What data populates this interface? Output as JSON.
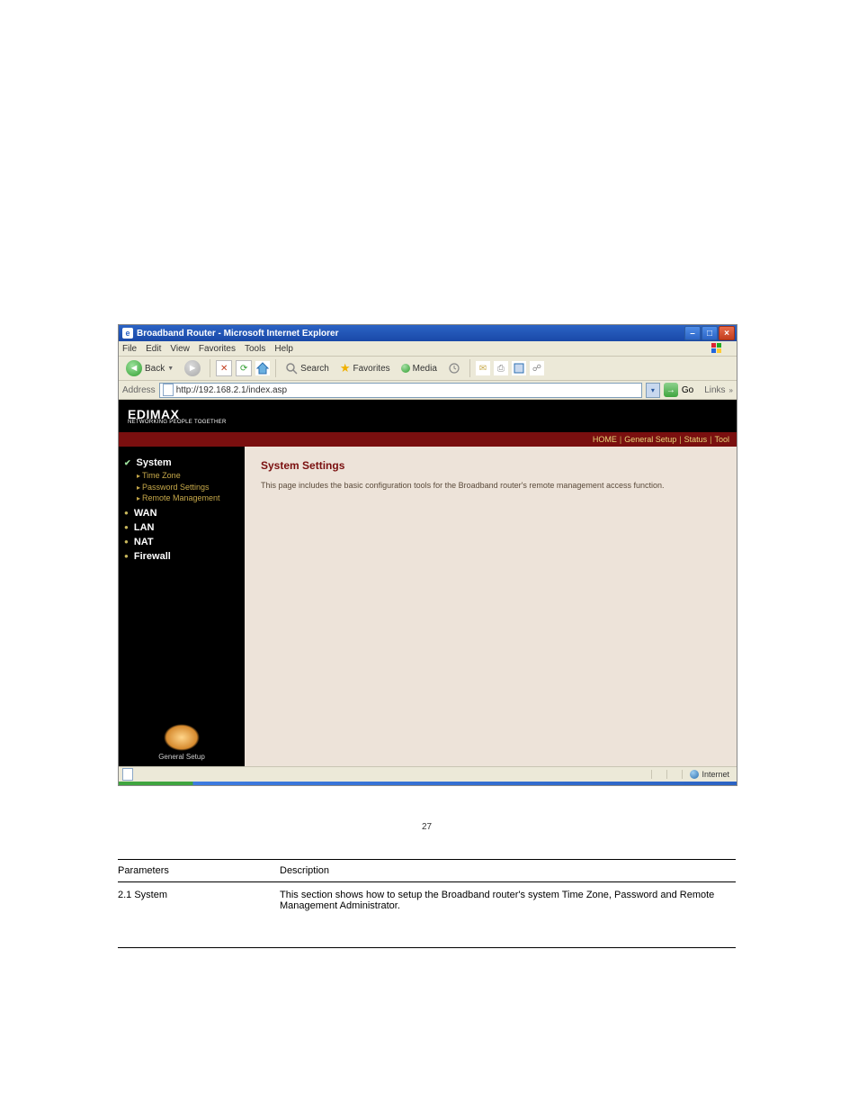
{
  "doc": {
    "page_number": "27",
    "heading_row": {
      "param": "Parameters",
      "desc": "Description"
    },
    "row": {
      "param": "2.1 System",
      "desc": "This section shows how to setup the Broadband router's system Time Zone, Password and Remote Management Administrator."
    }
  },
  "window": {
    "title": "Broadband Router - Microsoft Internet Explorer",
    "menu": [
      "File",
      "Edit",
      "View",
      "Favorites",
      "Tools",
      "Help"
    ],
    "toolbar": {
      "back": "Back",
      "search": "Search",
      "favorites": "Favorites",
      "media": "Media"
    },
    "address": {
      "label": "Address",
      "value": "http://192.168.2.1/index.asp",
      "go": "Go",
      "links": "Links"
    },
    "status": {
      "zone": "Internet"
    }
  },
  "router": {
    "brand": "EDIMAX",
    "brand_sub": "NETWORKING PEOPLE TOGETHER",
    "topnav": [
      "HOME",
      "General Setup",
      "Status",
      "Tool"
    ],
    "sidebar": {
      "system": "System",
      "system_children": [
        "Time Zone",
        "Password Settings",
        "Remote Management"
      ],
      "cats": [
        "WAN",
        "LAN",
        "NAT",
        "Firewall"
      ],
      "footer_label": "General Setup"
    },
    "main": {
      "heading": "System Settings",
      "body": "This page includes the basic configuration tools for the Broadband router's remote management access function."
    }
  }
}
